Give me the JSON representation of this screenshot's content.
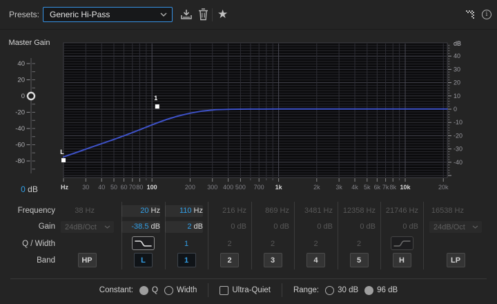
{
  "colors": {
    "accent_blue": "#32a0e8",
    "focus_blue": "#3792e3",
    "curve_blue": "#3e52c8",
    "handle_white": "#ffffff"
  },
  "topbar": {
    "presets_label": "Presets:",
    "preset_value": "Generic Hi-Pass",
    "icons": [
      "save-icon",
      "trash-icon",
      "favorite-star-icon",
      "dither-icon",
      "info-icon"
    ]
  },
  "master_gain": {
    "title": "Master Gain",
    "value_num": "0",
    "value_unit": "dB",
    "value_db": 0,
    "tick_labels": [
      40,
      20,
      0,
      -20,
      -40,
      -60,
      -80
    ]
  },
  "chart_data": {
    "type": "line",
    "x_axis": {
      "unit": "Hz",
      "scale": "log",
      "min": 20,
      "max": 21500,
      "ticks": [
        {
          "f": 20,
          "label": "Hz",
          "major": true,
          "edge": true
        },
        {
          "f": 30,
          "label": "30"
        },
        {
          "f": 40,
          "label": "40"
        },
        {
          "f": 50,
          "label": "50"
        },
        {
          "f": 60,
          "label": "60"
        },
        {
          "f": 70,
          "label": "70"
        },
        {
          "f": 80,
          "label": "80"
        },
        {
          "f": 90
        },
        {
          "f": 100,
          "label": "100",
          "major": true
        },
        {
          "f": 200,
          "label": "200"
        },
        {
          "f": 300,
          "label": "300"
        },
        {
          "f": 400,
          "label": "400"
        },
        {
          "f": 500,
          "label": "500"
        },
        {
          "f": 600
        },
        {
          "f": 700,
          "label": "700"
        },
        {
          "f": 800
        },
        {
          "f": 900
        },
        {
          "f": 1000,
          "label": "1k",
          "major": true
        },
        {
          "f": 2000,
          "label": "2k"
        },
        {
          "f": 3000,
          "label": "3k"
        },
        {
          "f": 4000,
          "label": "4k"
        },
        {
          "f": 5000,
          "label": "5k"
        },
        {
          "f": 6000,
          "label": "6k"
        },
        {
          "f": 7000,
          "label": "7k"
        },
        {
          "f": 8000,
          "label": "8k"
        },
        {
          "f": 9000
        },
        {
          "f": 10000,
          "label": "10k",
          "major": true
        },
        {
          "f": 20000,
          "label": "20k"
        }
      ]
    },
    "y_axis": {
      "unit": "dB",
      "min": -51,
      "max": 50,
      "grid_step_db": 2,
      "label_step_db": 10,
      "labels": [
        40,
        30,
        20,
        10,
        0,
        -10,
        -20,
        -30,
        -40
      ]
    },
    "series": [
      {
        "name": "eq-response",
        "color": "#3e52c8",
        "points": [
          [
            20,
            -36
          ],
          [
            25,
            -32.8
          ],
          [
            32,
            -29.2
          ],
          [
            40,
            -26
          ],
          [
            50,
            -22.8
          ],
          [
            63,
            -19.3
          ],
          [
            80,
            -15.5
          ],
          [
            100,
            -11.8
          ],
          [
            110,
            -10.3
          ],
          [
            130,
            -7.8
          ],
          [
            160,
            -5.2
          ],
          [
            200,
            -3
          ],
          [
            250,
            -1.4
          ],
          [
            320,
            -0.4
          ],
          [
            420,
            -0.05
          ],
          [
            600,
            0.05
          ],
          [
            1000,
            0.1
          ],
          [
            5000,
            0.1
          ],
          [
            21500,
            0.1
          ]
        ]
      }
    ],
    "handles": [
      {
        "label": "L",
        "f": 20,
        "db": -38.5
      },
      {
        "label": "1",
        "f": 110,
        "db": 2
      }
    ]
  },
  "table": {
    "row_labels": [
      "Frequency",
      "Gain",
      "Q / Width",
      "Band"
    ],
    "columns": [
      {
        "id": "hp",
        "band": "HP",
        "freq": "38 Hz",
        "gain": "24dB/Oct",
        "gain_dropdown": true,
        "q": "",
        "state": "inactive"
      },
      {
        "id": "l",
        "band": "L",
        "freq_num": "20",
        "freq_unit": "Hz",
        "gain_num": "-38.5",
        "gain_unit": "dB",
        "q_icon": "lowpass",
        "state": "active"
      },
      {
        "id": "1",
        "band": "1",
        "freq_num": "110",
        "freq_unit": "Hz",
        "gain_num": "2",
        "gain_unit": "dB",
        "q": "1",
        "state": "active"
      },
      {
        "id": "2",
        "band": "2",
        "freq": "216 Hz",
        "gain": "0 dB",
        "q": "2",
        "state": "inactive"
      },
      {
        "id": "3",
        "band": "3",
        "freq": "869 Hz",
        "gain": "0 dB",
        "q": "2",
        "state": "inactive"
      },
      {
        "id": "4",
        "band": "4",
        "freq": "3481 Hz",
        "gain": "0 dB",
        "q": "2",
        "state": "inactive"
      },
      {
        "id": "5",
        "band": "5",
        "freq": "12358 Hz",
        "gain": "0 dB",
        "q": "2",
        "state": "inactive"
      },
      {
        "id": "h",
        "band": "H",
        "freq": "21746 Hz",
        "gain": "0 dB",
        "q_icon": "shelf",
        "state": "inactive"
      },
      {
        "id": "lp",
        "band": "LP",
        "freq": "16538 Hz",
        "gain": "24dB/Oct",
        "gain_dropdown": true,
        "q": "",
        "state": "inactive"
      }
    ]
  },
  "footer": {
    "constant_label": "Constant:",
    "constant_options": [
      {
        "label": "Q",
        "selected": true
      },
      {
        "label": "Width",
        "selected": false
      }
    ],
    "ultra_quiet": {
      "label": "Ultra-Quiet",
      "checked": false
    },
    "range_label": "Range:",
    "range_options": [
      {
        "label": "30 dB",
        "selected": false
      },
      {
        "label": "96 dB",
        "selected": true
      }
    ]
  }
}
